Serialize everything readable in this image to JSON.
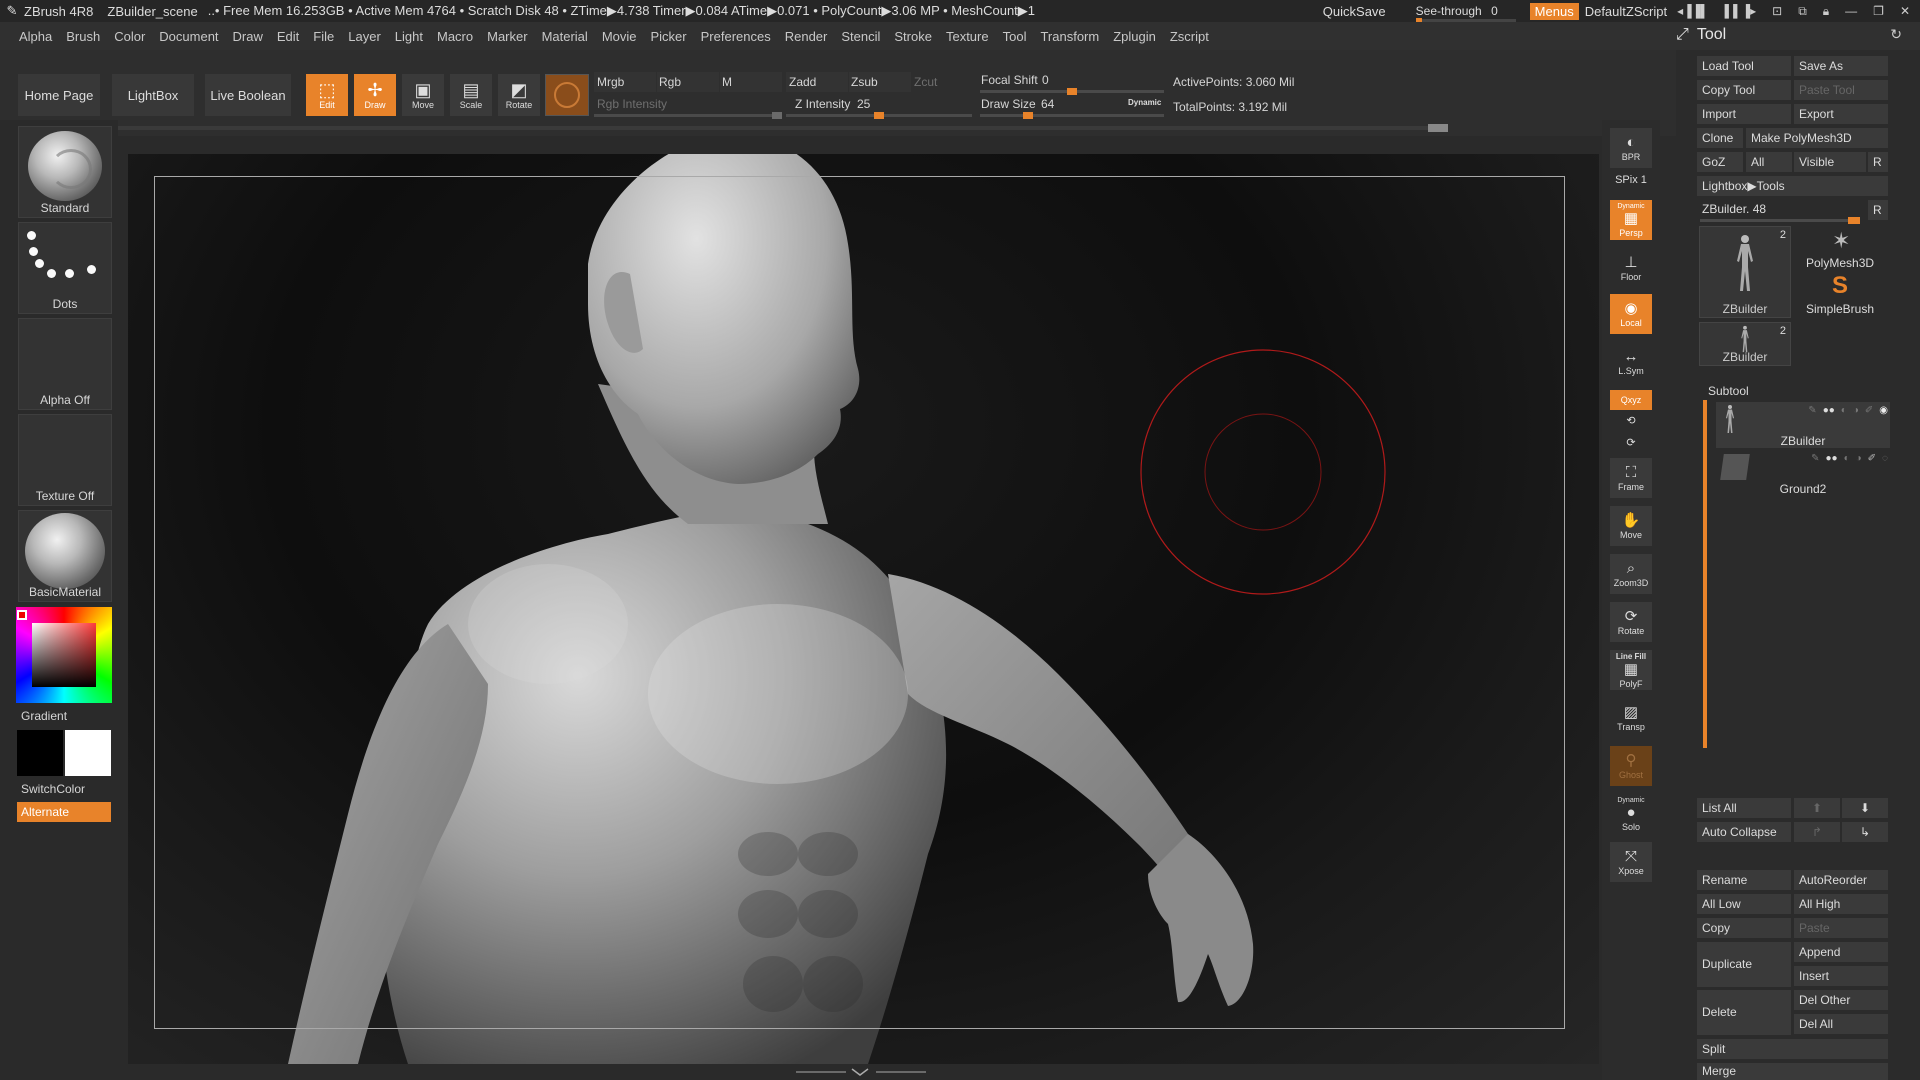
{
  "titlebar": {
    "app": "ZBrush 4R8",
    "scene": "ZBuilder_scene",
    "stats": "..• Free Mem 16.253GB • Active Mem 4764 • Scratch Disk 48 • ZTime▶4.738 Timer▶0.084 ATime▶0.071 • PolyCount▶3.06 MP • MeshCount▶1",
    "quicksave": "QuickSave",
    "seethrough_label": "See-through",
    "seethrough_value": "0",
    "menus": "Menus",
    "script": "DefaultZScript"
  },
  "menubar": {
    "items": [
      "Alpha",
      "Brush",
      "Color",
      "Document",
      "Draw",
      "Edit",
      "File",
      "Layer",
      "Light",
      "Macro",
      "Marker",
      "Material",
      "Movie",
      "Picker",
      "Preferences",
      "Render",
      "Stencil",
      "Stroke",
      "Texture",
      "Tool",
      "Transform",
      "Zplugin",
      "Zscript"
    ],
    "tool_title": "Tool"
  },
  "shelf": {
    "home": "Home Page",
    "lightbox": "LightBox",
    "live_boolean": "Live Boolean",
    "edit": "Edit",
    "draw": "Draw",
    "move": "Move",
    "scale": "Scale",
    "rotate": "Rotate",
    "mrgb": "Mrgb",
    "rgb": "Rgb",
    "m": "M",
    "zadd": "Zadd",
    "zsub": "Zsub",
    "zcut": "Zcut",
    "rgb_intensity": "Rgb Intensity",
    "z_intensity_label": "Z Intensity",
    "z_intensity": "25",
    "focal_shift_label": "Focal Shift",
    "focal_shift": "0",
    "draw_size_label": "Draw Size",
    "draw_size": "64",
    "dynamic": "Dynamic",
    "active_points": "ActivePoints: 3.060 Mil",
    "total_points": "TotalPoints: 3.192 Mil"
  },
  "lefttray": {
    "brush": "Standard",
    "stroke": "Dots",
    "alpha": "Alpha Off",
    "texture": "Texture Off",
    "material": "BasicMaterial",
    "gradient": "Gradient",
    "switchcolor": "SwitchColor",
    "alternate": "Alternate"
  },
  "rstrip": {
    "bpr": "BPR",
    "spix": "SPix 1",
    "dynamic": "Dynamic",
    "persp": "Persp",
    "floor": "Floor",
    "local": "Local",
    "lsym": "L.Sym",
    "xyz": "Qxyz",
    "frame": "Frame",
    "move": "Move",
    "zoom3d": "Zoom3D",
    "rotate": "Rotate",
    "line_fill": "Line Fill",
    "polyf": "PolyF",
    "transp": "Transp",
    "ghost": "Ghost",
    "dynamic2": "Dynamic",
    "solo": "Solo",
    "xpose": "Xpose"
  },
  "tool": {
    "load_tool": "Load Tool",
    "save_as": "Save As",
    "copy_tool": "Copy Tool",
    "paste_tool": "Paste Tool",
    "import": "Import",
    "export": "Export",
    "clone": "Clone",
    "make_polymesh": "Make PolyMesh3D",
    "goz": "GoZ",
    "all": "All",
    "visible": "Visible",
    "r": "R",
    "lightbox_tools": "Lightbox▶Tools",
    "zbuilder_slider": "ZBuilder. 48",
    "thumb1_name": "ZBuilder",
    "thumb1_count": "2",
    "polymesh3d": "PolyMesh3D",
    "simplebrush": "SimpleBrush",
    "thumb2_name": "ZBuilder",
    "thumb2_count": "2",
    "subtool": "Subtool",
    "subtool1": "ZBuilder",
    "subtool2": "Ground2",
    "list_all": "List All",
    "auto_collapse": "Auto Collapse",
    "rename": "Rename",
    "autoreorder": "AutoReorder",
    "all_low": "All Low",
    "all_high": "All High",
    "copy": "Copy",
    "paste": "Paste",
    "duplicate": "Duplicate",
    "append": "Append",
    "insert": "Insert",
    "delete": "Delete",
    "del_other": "Del Other",
    "del_all": "Del All",
    "split": "Split",
    "merge": "Merge"
  },
  "colors": {
    "accent": "#e8832a",
    "panel": "#2b2b2b",
    "button": "#3a3a3a"
  }
}
